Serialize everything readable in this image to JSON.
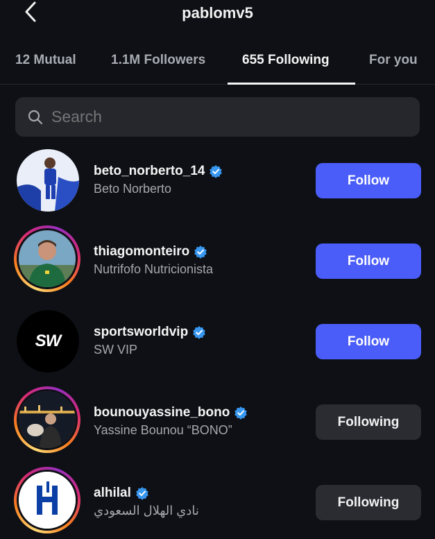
{
  "header": {
    "username": "pablomv5"
  },
  "tabs": [
    {
      "label": "12 Mutual",
      "active": false
    },
    {
      "label": "1.1M Followers",
      "active": false
    },
    {
      "label": "655 Following",
      "active": true
    },
    {
      "label": "For you",
      "active": false
    }
  ],
  "search": {
    "placeholder": "Search"
  },
  "colors": {
    "background": "#0e1015",
    "follow_button": "#4a5df9",
    "following_button": "#2a2c32",
    "verified": "#3897f0"
  },
  "accounts": [
    {
      "handle": "beto_norberto_14",
      "name": "Beto Norberto",
      "verified": true,
      "button": "Follow"
    },
    {
      "handle": "thiagomonteiro",
      "name": "Nutrifofo Nutricionista",
      "verified": true,
      "button": "Follow"
    },
    {
      "handle": "sportsworldvip",
      "name": "SW VIP",
      "verified": true,
      "button": "Follow",
      "avatar_text": "SW"
    },
    {
      "handle": "bounouyassine_bono",
      "name": "Yassine Bounou “BONO”",
      "verified": true,
      "button": "Following"
    },
    {
      "handle": "alhilal",
      "name": "نادي الهلال السعودي",
      "verified": true,
      "button": "Following"
    }
  ]
}
